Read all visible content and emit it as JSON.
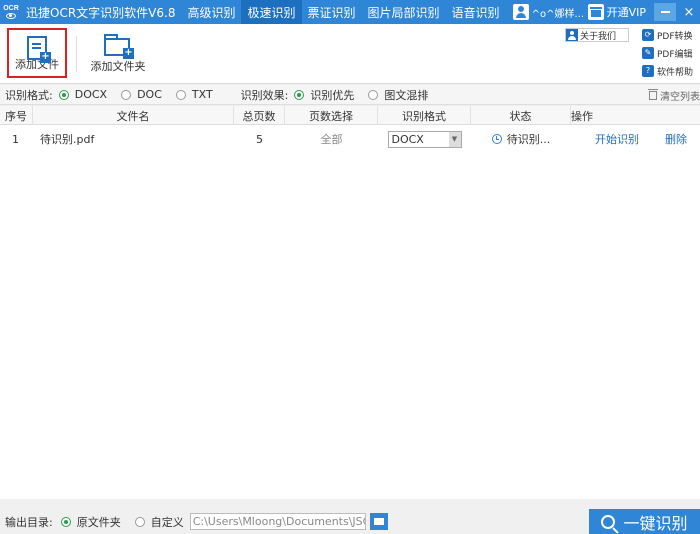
{
  "titlebar": {
    "logo_text": "OCR",
    "app_title": "迅捷OCR文字识别软件V6.8",
    "tabs": [
      {
        "label": "高级识别",
        "active": false
      },
      {
        "label": "极速识别",
        "active": true
      },
      {
        "label": "票证识别",
        "active": false
      },
      {
        "label": "图片局部识别",
        "active": false
      },
      {
        "label": "语音识别",
        "active": false
      }
    ],
    "username": "^o^娜样...",
    "vip_label": "开通VIP",
    "close_glyph": "×"
  },
  "toolbar": {
    "add_file": "添加文件",
    "add_folder": "添加文件夹",
    "about": "关于我们",
    "side_links": [
      {
        "label": "PDF转换",
        "icon": "pdf-convert-icon"
      },
      {
        "label": "PDF编辑",
        "icon": "pdf-edit-icon"
      },
      {
        "label": "软件帮助",
        "icon": "help-icon",
        "glyph": "?"
      }
    ]
  },
  "options": {
    "format_label": "识别格式:",
    "formats": [
      {
        "label": "DOCX",
        "selected": true
      },
      {
        "label": "DOC",
        "selected": false
      },
      {
        "label": "TXT",
        "selected": false
      }
    ],
    "effect_label": "识别效果:",
    "effects": [
      {
        "label": "识别优先",
        "selected": true
      },
      {
        "label": "图文混排",
        "selected": false
      }
    ],
    "clear_list": "清空列表"
  },
  "table": {
    "headers": [
      "序号",
      "文件名",
      "总页数",
      "页数选择",
      "识别格式",
      "状态",
      "操作"
    ],
    "rows": [
      {
        "index": "1",
        "filename": "待识别.pdf",
        "pages": "5",
        "page_select": "全部",
        "format": "DOCX",
        "status": "待识别...",
        "start": "开始识别",
        "delete": "删除"
      }
    ]
  },
  "bottom": {
    "output_label": "输出目录:",
    "origin_folder": "原文件夹",
    "custom": "自定义",
    "path_value": "C:\\Users\\Mloong\\Documents\\JSOC",
    "recognize_all": "一键识别"
  },
  "colors": {
    "titlebar": "#2f85d6",
    "accent": "#1f6fc0",
    "radio_selected": "#2b9d4a",
    "highlight_border": "#e02020"
  }
}
